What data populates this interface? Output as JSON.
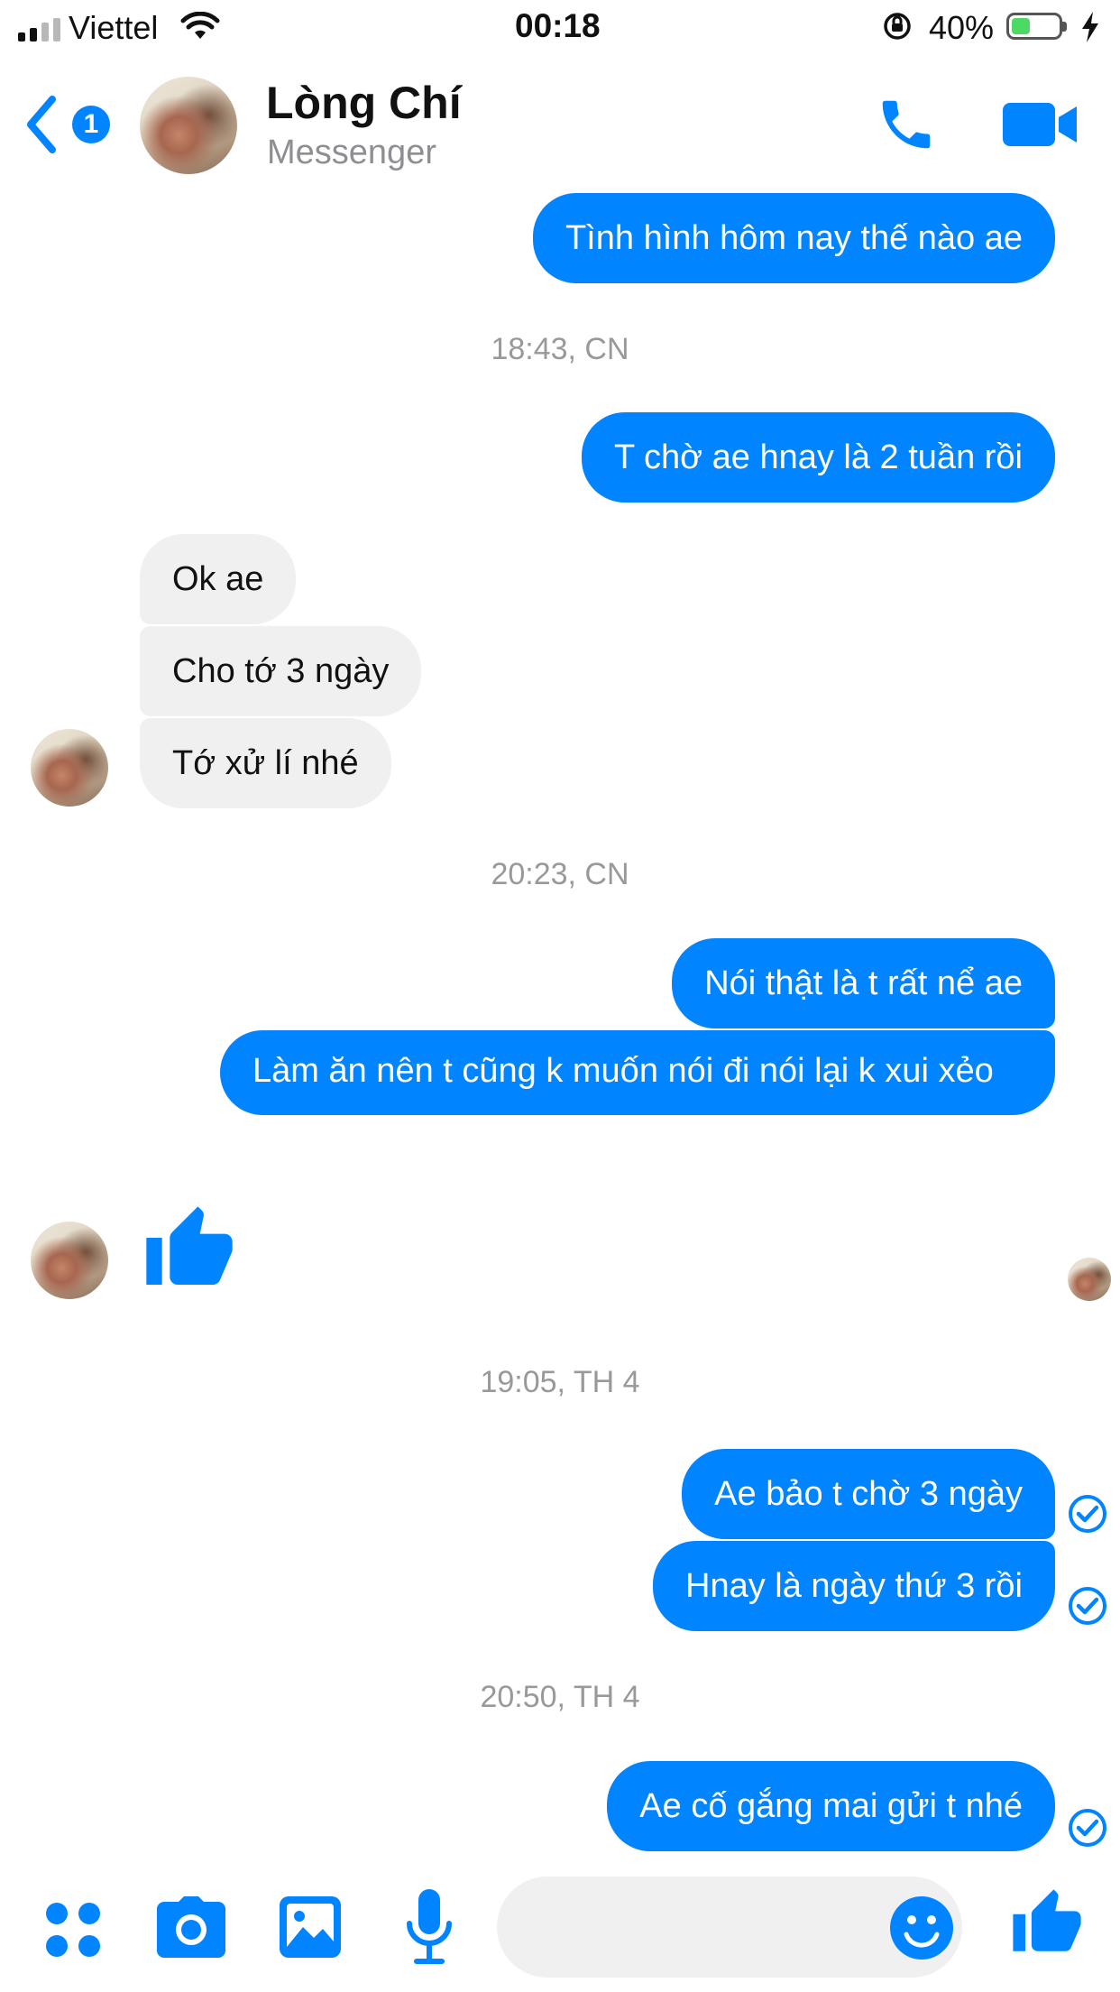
{
  "status_bar": {
    "carrier": "Viettel",
    "time": "00:18",
    "battery_percent": "40%",
    "battery_level": 0.4
  },
  "header": {
    "contact_name": "Lòng Chí",
    "subtitle": "Messenger",
    "back_badge_count": "1"
  },
  "conversation": {
    "messages": [
      {
        "text": "Tình hình hôm nay thế nào ae"
      },
      {
        "text": "18:43, CN"
      },
      {
        "text": "T chờ ae hnay là 2 tuần rồi"
      },
      {
        "text": "Ok ae"
      },
      {
        "text": "Cho tớ 3 ngày"
      },
      {
        "text": "Tớ xử lí nhé"
      },
      {
        "text": "20:23, CN"
      },
      {
        "text": "Nói thật là t rất nể ae"
      },
      {
        "text": "Làm ăn nên t cũng k muốn nói đi nói lại k xui xẻo"
      },
      {
        "text": "19:05, TH 4"
      },
      {
        "text": "Ae bảo t chờ 3 ngày"
      },
      {
        "text": "Hnay là ngày thứ 3 rồi"
      },
      {
        "text": "20:50, TH 4"
      },
      {
        "text": "Ae cố gắng mai gửi t nhé"
      }
    ]
  },
  "colors": {
    "accent": "#0084ff",
    "incoming_bubble": "#f1f0f0",
    "timestamp": "#999999"
  },
  "icons": [
    "back-chevron-icon",
    "phone-icon",
    "video-camera-icon",
    "thumbs-up-icon",
    "read-check-icon",
    "apps-grid-icon",
    "camera-icon",
    "gallery-icon",
    "microphone-icon",
    "emoji-icon"
  ]
}
